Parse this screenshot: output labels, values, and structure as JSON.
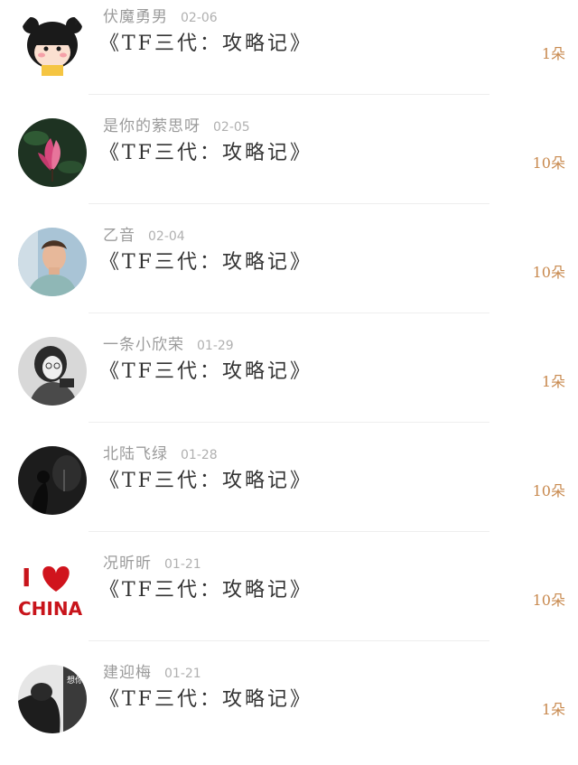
{
  "comments": [
    {
      "username": "伏魔勇男",
      "date": "02-06",
      "title": "《TF三代：攻略记》",
      "count": "1朵",
      "avatar": "cartoon-girl"
    },
    {
      "username": "是你的萦思呀",
      "date": "02-05",
      "title": "《TF三代：攻略记》",
      "count": "10朵",
      "avatar": "magnolia-flower"
    },
    {
      "username": "乙音",
      "date": "02-04",
      "title": "《TF三代：攻略记》",
      "count": "10朵",
      "avatar": "young-man"
    },
    {
      "username": "一条小欣荣",
      "date": "01-29",
      "title": "《TF三代：攻略记》",
      "count": "1朵",
      "avatar": "girl-bw"
    },
    {
      "username": "北陆飞绿",
      "date": "01-28",
      "title": "《TF三代：攻略记》",
      "count": "10朵",
      "avatar": "dark-silhouette"
    },
    {
      "username": "况昕昕",
      "date": "01-21",
      "title": "《TF三代：攻略记》",
      "count": "10朵",
      "avatar": "i-love-china",
      "avatar_text": {
        "letter": "I",
        "word": "CHINA"
      }
    },
    {
      "username": "建迎梅",
      "date": "01-21",
      "title": "《TF三代：攻略记》",
      "count": "1朵",
      "avatar": "bw-portrait",
      "avatar_text": "想你的夜"
    }
  ],
  "colors": {
    "count": "#c8894e",
    "username": "#9b9b9b",
    "title": "#333333"
  }
}
